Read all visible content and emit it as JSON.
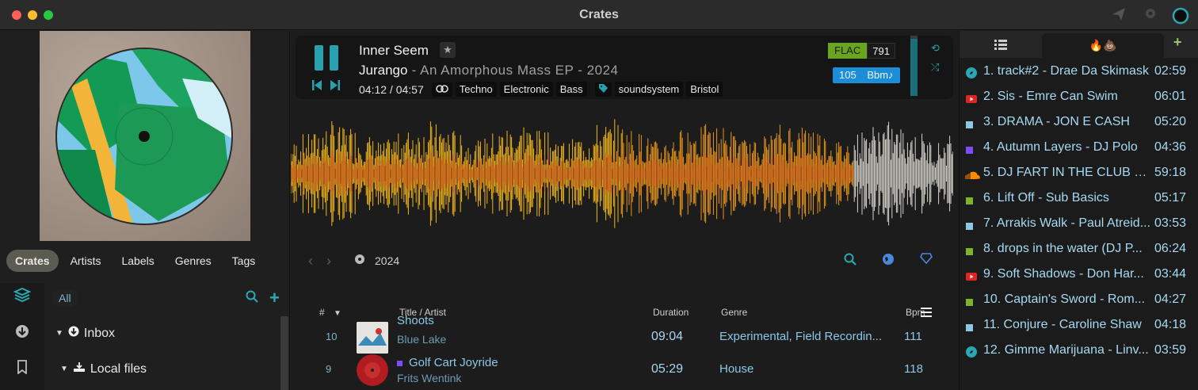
{
  "window": {
    "title": "Crates"
  },
  "toolbar": {
    "send_icon": "paper-plane-icon",
    "settings_icon": "gear-icon",
    "status_icon": "ring-icon"
  },
  "left": {
    "tabs": [
      "Crates",
      "Artists",
      "Labels",
      "Genres",
      "Tags"
    ],
    "active_tab": "Crates",
    "filter": {
      "all_label": "All"
    },
    "tree": [
      {
        "label": "Inbox",
        "icon": "download-circle-icon"
      },
      {
        "label": "Local files",
        "icon": "download-tray-icon"
      }
    ]
  },
  "player": {
    "title": "Inner Seem",
    "artist": "Jurango",
    "release_info": " - An Amorphous Mass EP - 2024",
    "time": "04:12 / 04:57",
    "tags": [
      "Techno",
      "Electronic",
      "Bass"
    ],
    "labels": [
      "soundsystem",
      "Bristol"
    ],
    "format": "FLAC",
    "bitrate": "791",
    "bpm_label": "105",
    "key_label": "Bbm♪",
    "progress": 0.85
  },
  "browser": {
    "year": "2024",
    "columns": {
      "num": "#",
      "title": "Title / Artist",
      "duration": "Duration",
      "genre": "Genre",
      "bpm": "Bpm"
    },
    "rows": [
      {
        "num": "10",
        "title": "Shoots",
        "artist": "Blue Lake",
        "duration": "09:04",
        "genre": "Experimental, Field Recordin...",
        "bpm": "111"
      },
      {
        "num": "9",
        "title": "Golf Cart Joyride",
        "artist": "Frits Wentink",
        "duration": "05:29",
        "genre": "House",
        "bpm": "118"
      }
    ]
  },
  "queue": {
    "tab_hot_label": "🔥💩",
    "items": [
      {
        "text": "1. track#2 - Drae Da Skimask",
        "time": "02:59",
        "source": "compass",
        "color": "#2aa7b0"
      },
      {
        "text": "2. Sis - Emre Can Swim",
        "time": "06:01",
        "source": "youtube",
        "color": "#e02424"
      },
      {
        "text": "3. DRAMA - JON E CASH",
        "time": "05:20",
        "source": "file",
        "color": "#8cc7e8"
      },
      {
        "text": "4. Autumn Layers - DJ Polo",
        "time": "04:36",
        "source": "bandcamp",
        "color": "#7c4dff"
      },
      {
        "text": "5. DJ FART IN THE CLUB w...",
        "time": "59:18",
        "source": "soundcloud",
        "color": "#ff8a00"
      },
      {
        "text": "6. Lift Off - Sub Basics",
        "time": "05:17",
        "source": "beatport",
        "color": "#7fb32b"
      },
      {
        "text": "7. Arrakis Walk - Paul Atreid...",
        "time": "03:53",
        "source": "file",
        "color": "#8cc7e8"
      },
      {
        "text": "8. drops in the water (DJ P...",
        "time": "06:24",
        "source": "beatport",
        "color": "#7fb32b"
      },
      {
        "text": "9. Soft Shadows - Don Har...",
        "time": "03:44",
        "source": "youtube",
        "color": "#e02424"
      },
      {
        "text": "10. Captain's Sword - Rom...",
        "time": "04:27",
        "source": "beatport",
        "color": "#7fb32b"
      },
      {
        "text": "11. Conjure - Caroline Shaw",
        "time": "04:18",
        "source": "file",
        "color": "#8cc7e8"
      },
      {
        "text": "12. Gimme Marijuana - Linv...",
        "time": "03:59",
        "source": "compass",
        "color": "#2aa7b0"
      }
    ]
  }
}
